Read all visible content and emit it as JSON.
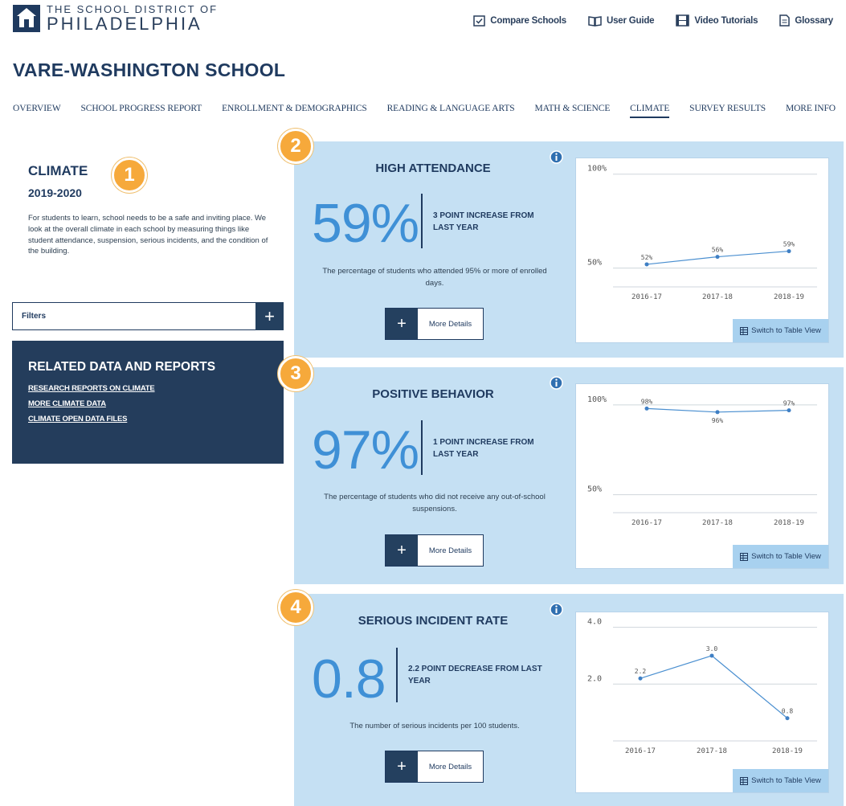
{
  "header": {
    "logo_line1": "THE SCHOOL DISTRICT OF",
    "logo_line2": "PHILADELPHIA",
    "links": [
      {
        "label": "Compare Schools",
        "icon": "checkbox-icon"
      },
      {
        "label": "User Guide",
        "icon": "book-icon"
      },
      {
        "label": "Video Tutorials",
        "icon": "film-icon"
      },
      {
        "label": "Glossary",
        "icon": "document-icon"
      }
    ]
  },
  "school_name": "VARE-WASHINGTON SCHOOL",
  "nav": [
    "OVERVIEW",
    "SCHOOL PROGRESS REPORT",
    "ENROLLMENT & DEMOGRAPHICS",
    "READING & LANGUAGE ARTS",
    "MATH & SCIENCE",
    "CLIMATE",
    "SURVEY RESULTS",
    "MORE INFO"
  ],
  "nav_active": "CLIMATE",
  "climate": {
    "title": "CLIMATE",
    "year": "2019-2020",
    "description": "For students to learn, school needs to be a safe and inviting place. We look at the overall climate in each school by measuring things like student attendance, suspension, serious incidents, and the condition of the building."
  },
  "filters": {
    "label": "Filters",
    "plus": "+"
  },
  "related": {
    "title": "RELATED DATA AND REPORTS",
    "links": [
      "RESEARCH REPORTS ON CLIMATE",
      "MORE CLIMATE DATA",
      "CLIMATE OPEN DATA FILES"
    ]
  },
  "badges": [
    "1",
    "2",
    "3",
    "4"
  ],
  "colors": {
    "accent": "#3f90d6",
    "navy": "#243d5c",
    "card_bg": "#c5e0f3",
    "badge": "#f6a93b"
  },
  "cards": [
    {
      "title": "HIGH ATTENDANCE",
      "value": "59%",
      "change": "3 POINT INCREASE FROM LAST YEAR",
      "description": "The percentage of students who attended 95% or more of enrolled days.",
      "more_label": "More Details",
      "switch_label": "Switch to Table View"
    },
    {
      "title": "POSITIVE BEHAVIOR",
      "value": "97%",
      "change": "1 POINT INCREASE FROM LAST YEAR",
      "description": "The percentage of students who did not receive any out-of-school suspensions.",
      "more_label": "More Details",
      "switch_label": "Switch to Table View"
    },
    {
      "title": "SERIOUS INCIDENT RATE",
      "value": "0.8",
      "change": "2.2 POINT DECREASE FROM LAST YEAR",
      "description": "The number of serious incidents per 100 students.",
      "more_label": "More Details",
      "switch_label": "Switch to Table View"
    }
  ],
  "chart_data": [
    {
      "type": "line",
      "x": [
        "2016-17",
        "2017-18",
        "2018-19"
      ],
      "series": [
        {
          "values": [
            52,
            56,
            59
          ]
        }
      ],
      "point_labels": [
        "52%",
        "56%",
        "59%"
      ],
      "y_ticks": [
        "100%",
        "50%"
      ],
      "ylim": [
        40,
        105
      ]
    },
    {
      "type": "line",
      "x": [
        "2016-17",
        "2017-18",
        "2018-19"
      ],
      "series": [
        {
          "values": [
            98,
            96,
            97
          ]
        }
      ],
      "point_labels": [
        "98%",
        "96%",
        "97%"
      ],
      "y_ticks": [
        "100%",
        "50%"
      ],
      "ylim": [
        40,
        108
      ]
    },
    {
      "type": "line",
      "x": [
        "2016-17",
        "2017-18",
        "2018-19"
      ],
      "series": [
        {
          "values": [
            2.2,
            3.0,
            0.8
          ]
        }
      ],
      "point_labels": [
        "2.2",
        "3.0",
        "0.8"
      ],
      "y_ticks": [
        "4.0",
        "2.0"
      ],
      "ylim": [
        0,
        4.3
      ]
    }
  ]
}
